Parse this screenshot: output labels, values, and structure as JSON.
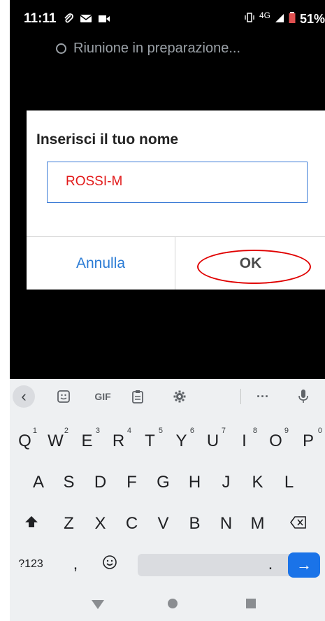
{
  "status_bar": {
    "time": "11:11",
    "left_icons": [
      "paperclip-icon",
      "gmail-icon",
      "video-icon"
    ],
    "network": "4G",
    "battery": "51%"
  },
  "meeting": {
    "status_text": "Riunione in preparazione..."
  },
  "dialog": {
    "title": "Inserisci il tuo nome",
    "name_value": "ROSSI-M",
    "cancel_label": "Annulla",
    "ok_label": "OK",
    "highlight_color": "#e00000"
  },
  "keyboard": {
    "toolbar": {
      "back": "‹",
      "gif": "GIF",
      "more": "···"
    },
    "row1": [
      {
        "key": "Q",
        "hint": "1"
      },
      {
        "key": "W",
        "hint": "2"
      },
      {
        "key": "E",
        "hint": "3"
      },
      {
        "key": "R",
        "hint": "4"
      },
      {
        "key": "T",
        "hint": "5"
      },
      {
        "key": "Y",
        "hint": "6"
      },
      {
        "key": "U",
        "hint": "7"
      },
      {
        "key": "I",
        "hint": "8"
      },
      {
        "key": "O",
        "hint": "9"
      },
      {
        "key": "P",
        "hint": "0"
      }
    ],
    "row2": [
      "A",
      "S",
      "D",
      "F",
      "G",
      "H",
      "J",
      "K",
      "L"
    ],
    "row3": [
      "Z",
      "X",
      "C",
      "V",
      "B",
      "N",
      "M"
    ],
    "row4": {
      "symbols": "?123",
      "comma": ",",
      "period": ".",
      "enter": "→"
    },
    "accent_color": "#1a73e8"
  }
}
